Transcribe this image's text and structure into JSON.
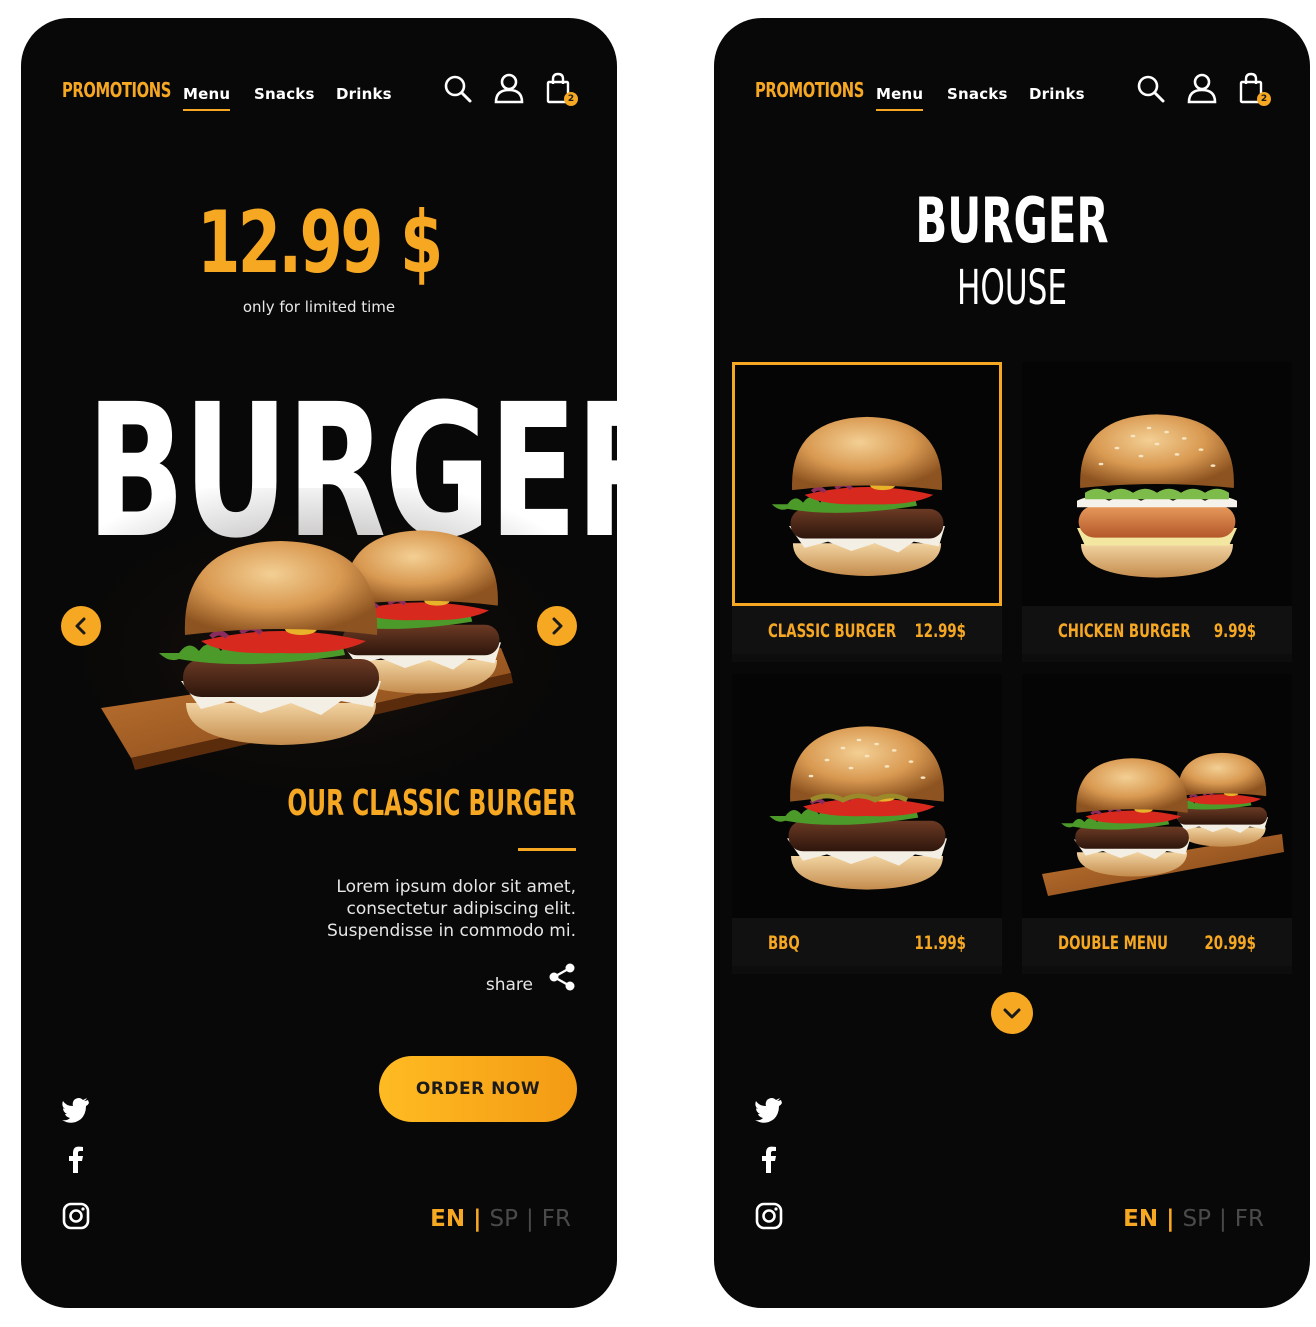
{
  "nav": {
    "promotions": "PROMOTIONS",
    "menu": "Menu",
    "snacks": "Snacks",
    "drinks": "Drinks",
    "cart_count": "2"
  },
  "promo_screen": {
    "price": "12.99 $",
    "price_note": "only for limited time",
    "hero_word": "BURGER",
    "section_title": "OUR CLASSIC BURGER",
    "description_lines": [
      "Lorem ipsum dolor sit amet,",
      "consectetur adipiscing elit.",
      "Suspendisse in commodo mi."
    ],
    "share_label": "share",
    "order_button": "ORDER NOW"
  },
  "menu_screen": {
    "title": "BURGER",
    "subtitle": "HOUSE",
    "items": [
      {
        "name": "CLASSIC BURGER",
        "price": "12.99$",
        "selected": true
      },
      {
        "name": "CHICKEN BURGER",
        "price": "9.99$",
        "selected": false
      },
      {
        "name": "BBQ",
        "price": "11.99$",
        "selected": false
      },
      {
        "name": "DOUBLE MENU",
        "price": "20.99$",
        "selected": false
      }
    ]
  },
  "languages": {
    "active": "EN",
    "others": [
      "SP",
      "FR"
    ],
    "separator": "|"
  },
  "social_icons": [
    "twitter-icon",
    "facebook-icon",
    "instagram-icon"
  ],
  "colors": {
    "accent": "#f7a823",
    "background": "#080808",
    "text": "#ffffff",
    "muted": "#4a4a4a"
  }
}
